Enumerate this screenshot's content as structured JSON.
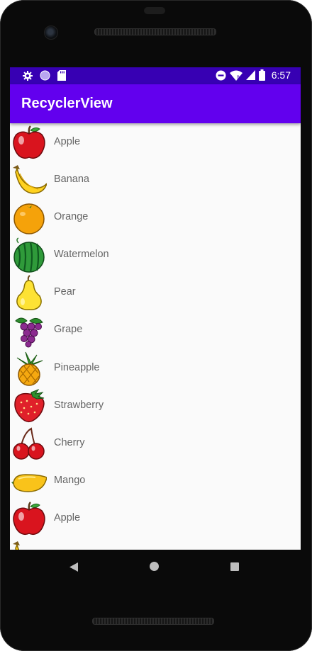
{
  "status_bar": {
    "time": "6:57",
    "left_icons": [
      "gear-icon",
      "circle-icon",
      "sd-card-icon"
    ],
    "right_icons": [
      "do-not-disturb-icon",
      "wifi-icon",
      "signal-icon",
      "battery-icon"
    ]
  },
  "app_bar": {
    "title": "RecyclerView"
  },
  "list": {
    "items": [
      {
        "label": "Apple",
        "icon": "apple-icon"
      },
      {
        "label": "Banana",
        "icon": "banana-icon"
      },
      {
        "label": "Orange",
        "icon": "orange-icon"
      },
      {
        "label": "Watermelon",
        "icon": "watermelon-icon"
      },
      {
        "label": "Pear",
        "icon": "pear-icon"
      },
      {
        "label": "Grape",
        "icon": "grape-icon"
      },
      {
        "label": "Pineapple",
        "icon": "pineapple-icon"
      },
      {
        "label": "Strawberry",
        "icon": "strawberry-icon"
      },
      {
        "label": "Cherry",
        "icon": "cherry-icon"
      },
      {
        "label": "Mango",
        "icon": "mango-icon"
      },
      {
        "label": "Apple",
        "icon": "apple-icon"
      }
    ]
  },
  "nav_bar": {
    "icons": [
      "back-icon",
      "home-icon",
      "recents-icon"
    ]
  },
  "colors": {
    "status_bar": "#3700b3",
    "app_bar": "#6200ee",
    "list_bg": "#fafafa",
    "label": "#666666"
  }
}
